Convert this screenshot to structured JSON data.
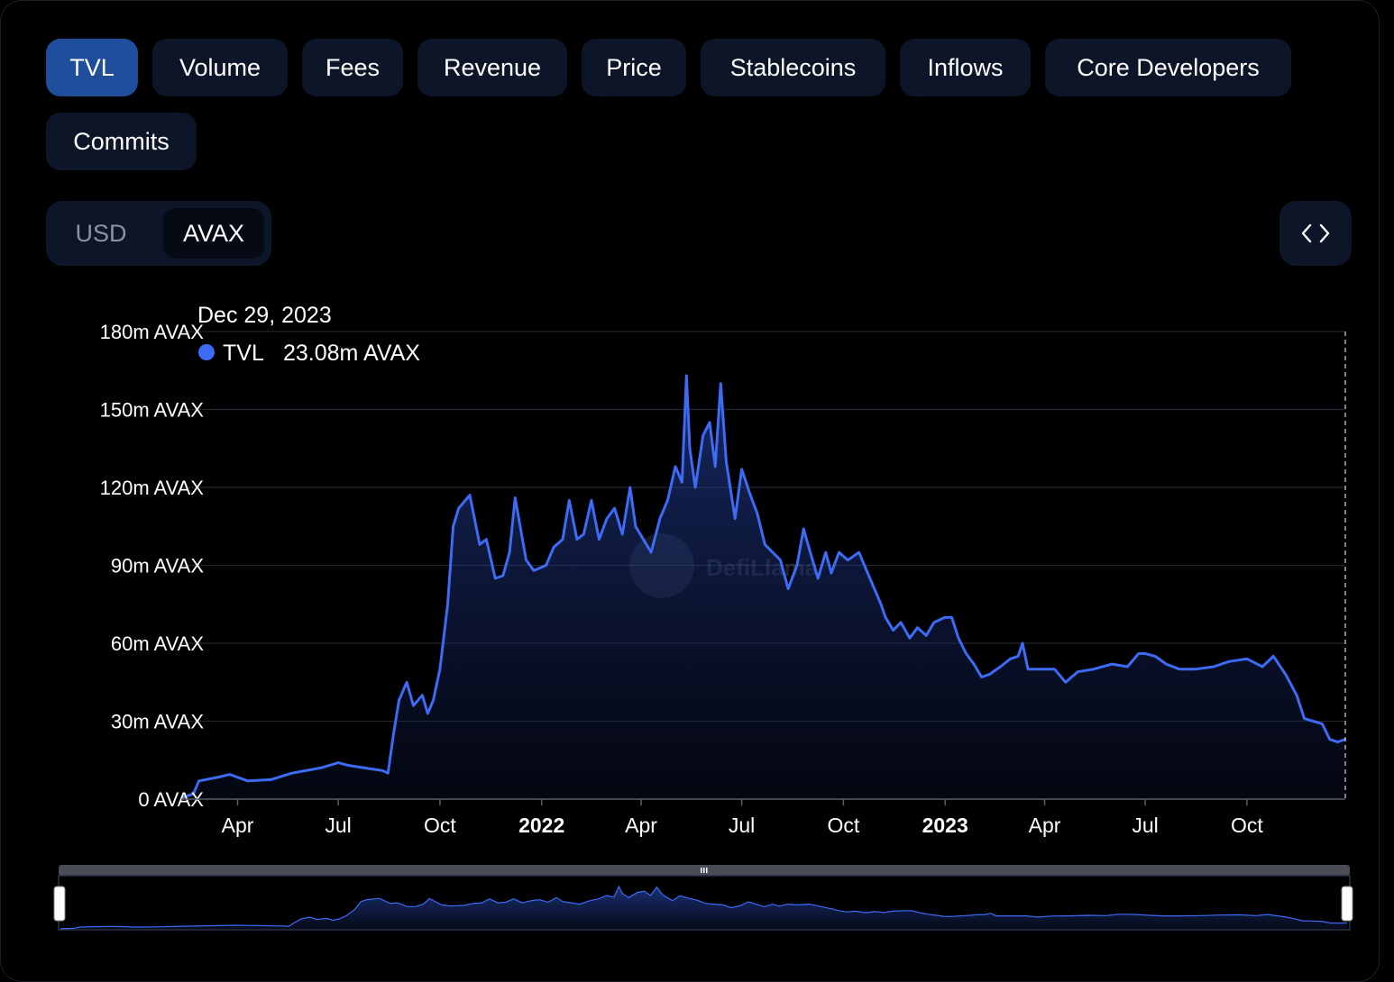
{
  "tabs": [
    "TVL",
    "Volume",
    "Fees",
    "Revenue",
    "Price",
    "Stablecoins",
    "Inflows",
    "Core Developers",
    "Commits"
  ],
  "active_tab": "TVL",
  "currency": {
    "options": [
      "USD",
      "AVAX"
    ],
    "selected": "AVAX"
  },
  "embed_icon": "code-brackets-icon",
  "watermark": "DefiLlama",
  "tooltip": {
    "date": "Dec 29, 2023",
    "series": "TVL",
    "value": "23.08m AVAX"
  },
  "colors": {
    "accent": "#3d6bf5",
    "tab_active": "#1f4f9c",
    "tab_bg": "#0d1628"
  },
  "chart_data": {
    "type": "area",
    "x_range": [
      "2021-02-09",
      "2023-12-29"
    ],
    "ylim": [
      0,
      180
    ],
    "y_ticks": [
      "0 AVAX",
      "30m AVAX",
      "60m AVAX",
      "90m AVAX",
      "120m AVAX",
      "150m AVAX",
      "180m AVAX"
    ],
    "x_ticks": [
      {
        "label": "Apr",
        "date": "2021-04-01",
        "bold": false
      },
      {
        "label": "Jul",
        "date": "2021-07-01",
        "bold": false
      },
      {
        "label": "Oct",
        "date": "2021-10-01",
        "bold": false
      },
      {
        "label": "2022",
        "date": "2022-01-01",
        "bold": true
      },
      {
        "label": "Apr",
        "date": "2022-04-01",
        "bold": false
      },
      {
        "label": "Jul",
        "date": "2022-07-01",
        "bold": false
      },
      {
        "label": "Oct",
        "date": "2022-10-01",
        "bold": false
      },
      {
        "label": "2023",
        "date": "2023-01-01",
        "bold": true
      },
      {
        "label": "Apr",
        "date": "2023-04-01",
        "bold": false
      },
      {
        "label": "Jul",
        "date": "2023-07-01",
        "bold": false
      },
      {
        "label": "Oct",
        "date": "2023-10-01",
        "bold": false
      }
    ],
    "series": [
      {
        "name": "TVL",
        "unit": "m AVAX",
        "points": [
          [
            "2021-02-09",
            0.5
          ],
          [
            "2021-02-20",
            2
          ],
          [
            "2021-02-25",
            7
          ],
          [
            "2021-03-15",
            8.5
          ],
          [
            "2021-03-25",
            9.5
          ],
          [
            "2021-04-10",
            7
          ],
          [
            "2021-05-01",
            7.5
          ],
          [
            "2021-05-20",
            10
          ],
          [
            "2021-06-15",
            12
          ],
          [
            "2021-07-01",
            14
          ],
          [
            "2021-07-10",
            13
          ],
          [
            "2021-07-25",
            12
          ],
          [
            "2021-08-10",
            11
          ],
          [
            "2021-08-15",
            10
          ],
          [
            "2021-08-20",
            25
          ],
          [
            "2021-08-25",
            38
          ],
          [
            "2021-09-01",
            45
          ],
          [
            "2021-09-07",
            36
          ],
          [
            "2021-09-15",
            40
          ],
          [
            "2021-09-20",
            33
          ],
          [
            "2021-09-25",
            38
          ],
          [
            "2021-10-01",
            50
          ],
          [
            "2021-10-08",
            75
          ],
          [
            "2021-10-13",
            105
          ],
          [
            "2021-10-18",
            112
          ],
          [
            "2021-10-28",
            117
          ],
          [
            "2021-11-06",
            98
          ],
          [
            "2021-11-12",
            100
          ],
          [
            "2021-11-20",
            85
          ],
          [
            "2021-11-27",
            86
          ],
          [
            "2021-12-03",
            95
          ],
          [
            "2021-12-08",
            116
          ],
          [
            "2021-12-13",
            104
          ],
          [
            "2021-12-18",
            92
          ],
          [
            "2021-12-25",
            88
          ],
          [
            "2022-01-05",
            90
          ],
          [
            "2022-01-12",
            97
          ],
          [
            "2022-01-20",
            100
          ],
          [
            "2022-01-26",
            115
          ],
          [
            "2022-02-02",
            100
          ],
          [
            "2022-02-08",
            102
          ],
          [
            "2022-02-15",
            115
          ],
          [
            "2022-02-22",
            100
          ],
          [
            "2022-03-01",
            108
          ],
          [
            "2022-03-08",
            112
          ],
          [
            "2022-03-15",
            102
          ],
          [
            "2022-03-22",
            120
          ],
          [
            "2022-03-27",
            105
          ],
          [
            "2022-04-03",
            100
          ],
          [
            "2022-04-10",
            95
          ],
          [
            "2022-04-18",
            108
          ],
          [
            "2022-04-25",
            115
          ],
          [
            "2022-05-02",
            128
          ],
          [
            "2022-05-08",
            122
          ],
          [
            "2022-05-12",
            163
          ],
          [
            "2022-05-15",
            135
          ],
          [
            "2022-05-20",
            120
          ],
          [
            "2022-05-27",
            140
          ],
          [
            "2022-06-02",
            145
          ],
          [
            "2022-06-07",
            128
          ],
          [
            "2022-06-12",
            160
          ],
          [
            "2022-06-17",
            130
          ],
          [
            "2022-06-25",
            108
          ],
          [
            "2022-07-01",
            127
          ],
          [
            "2022-07-08",
            118
          ],
          [
            "2022-07-15",
            110
          ],
          [
            "2022-07-22",
            98
          ],
          [
            "2022-07-29",
            95
          ],
          [
            "2022-08-05",
            92
          ],
          [
            "2022-08-12",
            81
          ],
          [
            "2022-08-20",
            90
          ],
          [
            "2022-08-26",
            104
          ],
          [
            "2022-09-01",
            95
          ],
          [
            "2022-09-08",
            85
          ],
          [
            "2022-09-15",
            95
          ],
          [
            "2022-09-20",
            87
          ],
          [
            "2022-09-27",
            95
          ],
          [
            "2022-10-05",
            92
          ],
          [
            "2022-10-15",
            95
          ],
          [
            "2022-10-22",
            88
          ],
          [
            "2022-10-28",
            82
          ],
          [
            "2022-11-04",
            75
          ],
          [
            "2022-11-08",
            70
          ],
          [
            "2022-11-15",
            65
          ],
          [
            "2022-11-22",
            68
          ],
          [
            "2022-11-30",
            62
          ],
          [
            "2022-12-07",
            66
          ],
          [
            "2022-12-15",
            63
          ],
          [
            "2022-12-22",
            68
          ],
          [
            "2023-01-01",
            70
          ],
          [
            "2023-01-07",
            70
          ],
          [
            "2023-01-13",
            62
          ],
          [
            "2023-01-20",
            56
          ],
          [
            "2023-01-27",
            52
          ],
          [
            "2023-02-03",
            47
          ],
          [
            "2023-02-10",
            48
          ],
          [
            "2023-02-20",
            51
          ],
          [
            "2023-03-01",
            54
          ],
          [
            "2023-03-08",
            55
          ],
          [
            "2023-03-12",
            60
          ],
          [
            "2023-03-17",
            50
          ],
          [
            "2023-03-27",
            50
          ],
          [
            "2023-04-10",
            50
          ],
          [
            "2023-04-20",
            45
          ],
          [
            "2023-05-01",
            49
          ],
          [
            "2023-05-15",
            50
          ],
          [
            "2023-06-01",
            52
          ],
          [
            "2023-06-15",
            51
          ],
          [
            "2023-06-25",
            56
          ],
          [
            "2023-07-01",
            56
          ],
          [
            "2023-07-10",
            55
          ],
          [
            "2023-07-20",
            52
          ],
          [
            "2023-08-01",
            50
          ],
          [
            "2023-08-15",
            50
          ],
          [
            "2023-09-01",
            51
          ],
          [
            "2023-09-15",
            53
          ],
          [
            "2023-10-01",
            54
          ],
          [
            "2023-10-15",
            51
          ],
          [
            "2023-10-25",
            55
          ],
          [
            "2023-11-05",
            48
          ],
          [
            "2023-11-15",
            40
          ],
          [
            "2023-11-22",
            31
          ],
          [
            "2023-11-30",
            30
          ],
          [
            "2023-12-08",
            29
          ],
          [
            "2023-12-15",
            23
          ],
          [
            "2023-12-22",
            22
          ],
          [
            "2023-12-29",
            23.08
          ]
        ]
      }
    ]
  }
}
